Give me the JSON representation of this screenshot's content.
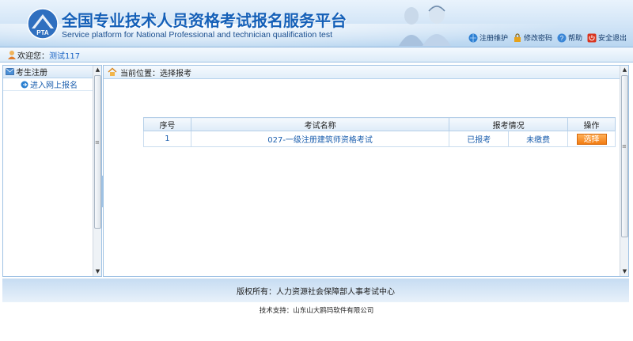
{
  "header": {
    "logo_text": "PTA",
    "title_cn": "全国专业技术人员资格考试报名服务平台",
    "title_en": "Service platform for National Professional and technician qualification test",
    "links": [
      {
        "label": "注册维护",
        "icon": "globe-icon"
      },
      {
        "label": "修改密码",
        "icon": "lock-icon"
      },
      {
        "label": "帮助",
        "icon": "help-icon"
      },
      {
        "label": "安全退出",
        "icon": "power-icon"
      }
    ]
  },
  "welcome": {
    "label": "欢迎您：",
    "user": "测试117"
  },
  "sidebar": {
    "section": "考生注册",
    "items": [
      {
        "label": "进入网上报名"
      }
    ]
  },
  "main": {
    "breadcrumb": "当前位置：选择报考",
    "table": {
      "headers": [
        "序号",
        "考试名称",
        "报考情况",
        "操作"
      ],
      "rows": [
        {
          "index": "1",
          "name": "027-一级注册建筑师资格考试",
          "status1": "已报考",
          "status2": "未缴费",
          "action": "选择"
        }
      ]
    }
  },
  "footer": {
    "copyright": "版权所有：人力资源社会保障部人事考试中心",
    "support": "技术支持：山东山大鸥玛软件有限公司"
  },
  "colors": {
    "brand_blue": "#1560b8",
    "link_blue": "#1c5fae",
    "button_orange": "#f27c12"
  }
}
